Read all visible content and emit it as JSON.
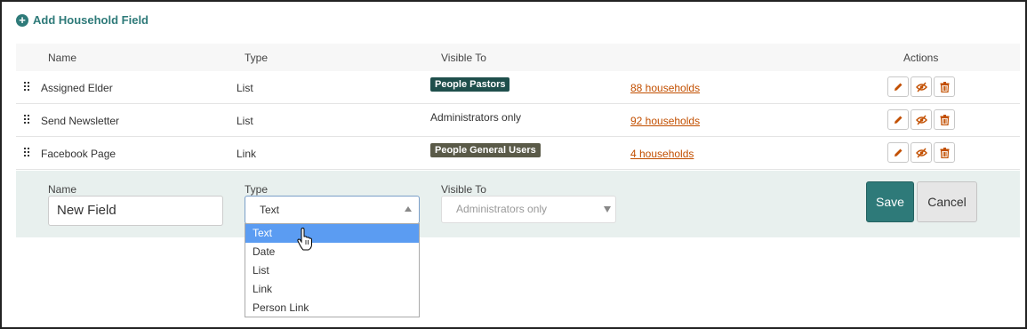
{
  "add_field_label": "Add Household Field",
  "headers": {
    "name": "Name",
    "type": "Type",
    "visible_to": "Visible To",
    "actions": "Actions"
  },
  "rows": [
    {
      "name": "Assigned Elder",
      "type": "List",
      "visible_to": "People Pastors",
      "visible_style": "badge",
      "badge_color": "#1f4f4c",
      "households": "88 households"
    },
    {
      "name": "Send Newsletter",
      "type": "List",
      "visible_to": "Administrators only",
      "visible_style": "text",
      "households": "92 households"
    },
    {
      "name": "Facebook Page",
      "type": "Link",
      "visible_to": "People General Users",
      "visible_style": "badge",
      "badge_color": "#5a5a48",
      "households": "4 households"
    }
  ],
  "edit_form": {
    "name_label": "Name",
    "name_value": "New Field",
    "type_label": "Type",
    "type_value": "Text",
    "visible_label": "Visible To",
    "visible_value": "Administrators only",
    "save_label": "Save",
    "cancel_label": "Cancel"
  },
  "type_options": [
    "Text",
    "Date",
    "List",
    "Link",
    "Person Link"
  ],
  "selected_option": "Text",
  "colors": {
    "accent": "#2e7a79",
    "link": "#c24f00",
    "action_icon": "#c24f00",
    "option_highlight": "#5b9cf2"
  },
  "icons": {
    "add": "plus-circle-icon",
    "edit": "pencil-icon",
    "hide": "eye-slash-icon",
    "delete": "trash-icon",
    "drag": "drag-handle-icon"
  }
}
